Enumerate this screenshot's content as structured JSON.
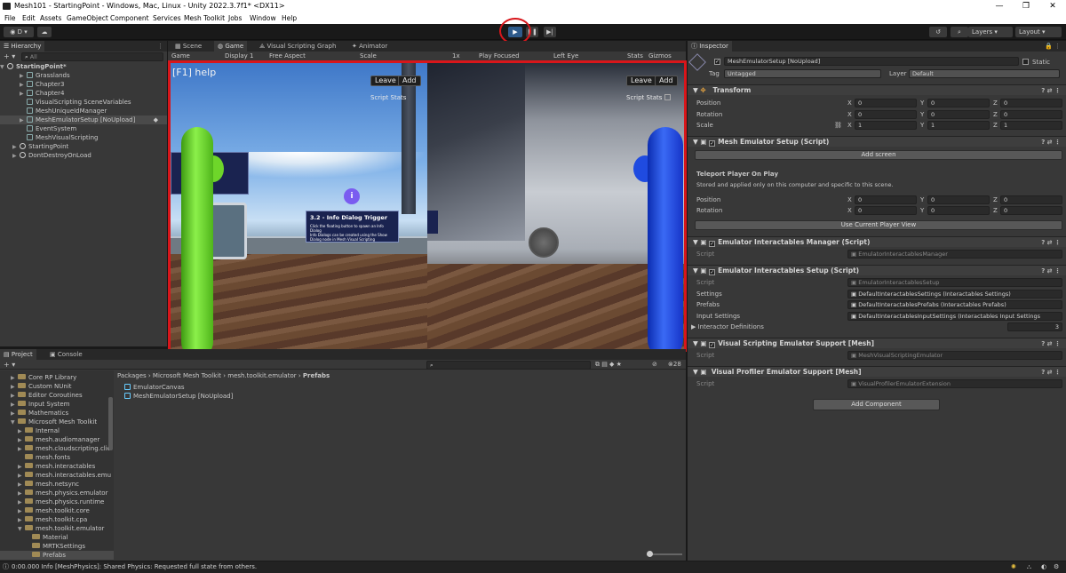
{
  "window": {
    "title": "Mesh101 - StartingPoint - Windows, Mac, Linux - Unity 2022.3.7f1* <DX11>"
  },
  "menu": [
    "File",
    "Edit",
    "Assets",
    "GameObject",
    "Component",
    "Services",
    "Mesh Toolkit",
    "Jobs",
    "Window",
    "Help"
  ],
  "toolbar": {
    "account": "D",
    "layers": "Layers",
    "layout": "Layout"
  },
  "hierarchy": {
    "tab": "Hierarchy",
    "search_placeholder": "All",
    "items": [
      "StartingPoint*",
      "Grasslands",
      "Chapter3",
      "Chapter4",
      "VisualScripting SceneVariables",
      "MeshUniqueIdManager",
      "MeshEmulatorSetup [NoUpload]",
      "EventSystem",
      "MeshVisualScripting",
      "StartingPoint",
      "DontDestroyOnLoad"
    ]
  },
  "scene_tabs": [
    "Scene",
    "Game",
    "Visual Scripting Graph",
    "Animator"
  ],
  "game_toolbar": [
    "Game",
    "Display 1",
    "Free Aspect",
    "Scale",
    "1x",
    "Play Focused",
    "Left Eye",
    "Stats",
    "Gizmos"
  ],
  "game_view": {
    "help": "[F1] help",
    "leave": "Leave",
    "add": "Add",
    "script_stats": "Script Stats",
    "panel_title": "3.2 - Info Dialog Trigger",
    "panel_lines": [
      "Click the floating button to spawn an Info Dialog",
      "Info Dialogs can be created using the Show Dialog node in Mesh Visual Scripting"
    ],
    "info_glyph": "i"
  },
  "project": {
    "tabs": [
      "Project",
      "Console"
    ],
    "tree": [
      "Core RP Library",
      "Custom NUnit",
      "Editor Coroutines",
      "Input System",
      "Mathematics",
      "Microsoft Mesh Toolkit",
      "Internal",
      "mesh.audiomanager",
      "mesh.cloudscripting.clie",
      "mesh.fonts",
      "mesh.interactables",
      "mesh.interactables.emu",
      "mesh.netsync",
      "mesh.physics.emulator",
      "mesh.physics.runtime",
      "mesh.toolkit.core",
      "mesh.toolkit.cpa",
      "mesh.toolkit.emulator",
      "Material",
      "MRTKSettings",
      "Prefabs"
    ],
    "breadcrumb": [
      "Packages",
      "Microsoft Mesh Toolkit",
      "mesh.toolkit.emulator",
      "Prefabs"
    ],
    "files": [
      "EmulatorCanvas",
      "MeshEmulatorSetup [NoUpload]"
    ],
    "count": "28"
  },
  "inspector": {
    "tab": "Inspector",
    "object_name": "MeshEmulatorSetup [NoUpload]",
    "static": "Static",
    "tag_label": "Tag",
    "tag": "Untagged",
    "layer_label": "Layer",
    "layer": "Default",
    "transform": {
      "title": "Transform",
      "position": [
        "0",
        "0",
        "0"
      ],
      "rotation": [
        "0",
        "0",
        "0"
      ],
      "scale": [
        "1",
        "1",
        "1"
      ],
      "labels": [
        "Position",
        "Rotation",
        "Scale"
      ]
    },
    "axes": [
      "X",
      "Y",
      "Z"
    ],
    "mesh_emulator": {
      "title": "Mesh Emulator Setup (Script)",
      "add_screen": "Add screen",
      "teleport": "Teleport Player On Play",
      "note": "Stored and applied only on this computer and specific to this scene.",
      "position": [
        "0",
        "0",
        "0"
      ],
      "rotation": [
        "0",
        "0",
        "0"
      ],
      "use_view": "Use Current Player View"
    },
    "interactables_manager": {
      "title": "Emulator Interactables Manager (Script)",
      "script": "EmulatorInteractablesManager"
    },
    "interactables_setup": {
      "title": "Emulator Interactables Setup (Script)",
      "script": "EmulatorInteractablesSetup",
      "settings": "DefaultInteractablesSettings (Interactables Settings)",
      "prefabs": "DefaultInteractablesPrefabs (Interactables Prefabs)",
      "input": "DefaultInteractablesInputSettings (Interactables Input Settings",
      "definitions": "3",
      "labels": [
        "Script",
        "Settings",
        "Prefabs",
        "Input Settings",
        "Interactor Definitions"
      ]
    },
    "vs_support": {
      "title": "Visual Scripting Emulator Support [Mesh]",
      "script": "MeshVisualScriptingEmulator"
    },
    "vp_support": {
      "title": "Visual Profiler Emulator Support [Mesh]",
      "script": "VisualProfilerEmulatorExtension"
    },
    "add_component": "Add Component"
  },
  "status": {
    "message": "0:00.000 Info [MeshPhysics]: Shared Physics: Requested full state from others."
  },
  "colors": {
    "highlight": "#d8161b",
    "green_avatar": "#6ed62a",
    "blue_avatar": "#1f4be0"
  }
}
